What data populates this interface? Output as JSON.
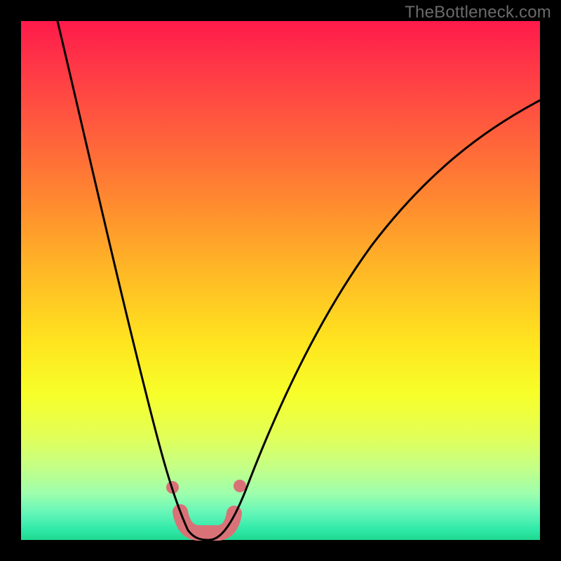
{
  "attribution": "TheBottleneck.com",
  "colors": {
    "frame": "#000000",
    "curve": "#000000",
    "trough_marker": "#d97277",
    "gradient_top": "#ff1a4b",
    "gradient_bottom": "#1fd98f"
  },
  "chart_data": {
    "type": "line",
    "title": "",
    "xlabel": "",
    "ylabel": "",
    "xlim": [
      0,
      100
    ],
    "ylim": [
      0,
      100
    ],
    "grid": false,
    "note": "Values estimated from pixel positions; y = bottleneck %, x = relative component balance. Minimum near x≈34.",
    "series": [
      {
        "name": "bottleneck-curve",
        "x": [
          5,
          8,
          11,
          14,
          17,
          20,
          23,
          26,
          28,
          30,
          32,
          34,
          36,
          38,
          40,
          44,
          50,
          58,
          66,
          74,
          82,
          90,
          98
        ],
        "y": [
          100,
          89,
          78,
          67,
          56,
          45,
          34,
          22,
          13,
          6,
          1,
          0,
          0,
          3,
          9,
          20,
          33,
          47,
          58,
          67,
          74,
          80,
          85
        ]
      }
    ],
    "trough_marker": {
      "x_range": [
        30,
        38
      ],
      "y": 0,
      "end_dots_x": [
        28.5,
        39
      ],
      "end_dots_y": [
        10,
        10
      ]
    }
  }
}
